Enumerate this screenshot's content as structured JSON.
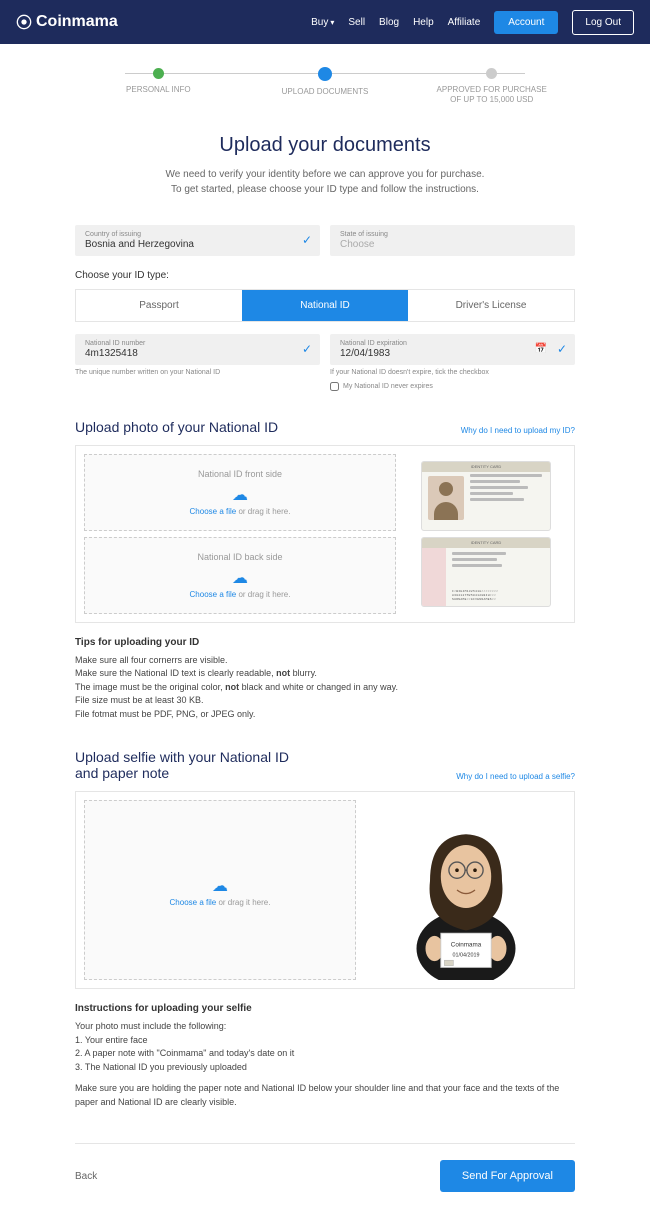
{
  "header": {
    "brand": "Coinmama",
    "nav": {
      "buy": "Buy",
      "sell": "Sell",
      "blog": "Blog",
      "help": "Help",
      "affiliate": "Affiliate"
    },
    "account": "Account",
    "logout": "Log Out"
  },
  "stepper": {
    "step1": "PERSONAL INFO",
    "step2": "UPLOAD DOCUMENTS",
    "step3": "APPROVED FOR PURCHASE\nOF UP TO 15,000 USD"
  },
  "title": "Upload your documents",
  "subtitle": "We need to verify your identity before we can approve you for purchase.\nTo get started, please choose your ID type and follow the instructions.",
  "country": {
    "label": "Country of issuing",
    "value": "Bosnia and Herzegovina"
  },
  "state": {
    "label": "State of issuing",
    "placeholder": "Choose"
  },
  "choose_label": "Choose your ID type:",
  "tabs": {
    "passport": "Passport",
    "national": "National ID",
    "license": "Driver's License"
  },
  "id_number": {
    "label": "National ID number",
    "value": "4m1325418",
    "hint": "The unique number written on your National ID"
  },
  "id_exp": {
    "label": "National ID expiration",
    "value": "12/04/1983",
    "hint": "If your National ID doesn't expire, tick the checkbox",
    "checkbox": "My National ID never expires"
  },
  "upload_id": {
    "title": "Upload photo of your National ID",
    "link": "Why do I need to upload my ID?",
    "front": "National ID front side",
    "back": "National ID back side",
    "choose": "Choose a file",
    "drag": " or drag it here."
  },
  "tips_id": {
    "title": "Tips for uploading your ID",
    "l1": "Make sure all four cornerrs are visible.",
    "l2a": "Make sure the National ID text is clearly readable, ",
    "l2b": "not",
    "l2c": " blurry.",
    "l3a": "The image must be the original color, ",
    "l3b": "not",
    "l3c": " black and white or changed in any way.",
    "l4": "File size must be at least 30 KB.",
    "l5": "File fotmat must be PDF, PNG, or JPEG only."
  },
  "upload_selfie": {
    "title": "Upload selfie with your National ID and paper note",
    "link": "Why do I need to upload a selfie?",
    "note_line1": "Coinmama",
    "note_line2": "01/04/2019"
  },
  "tips_selfie": {
    "title": "Instructions for uploading your selfie",
    "intro": "Your photo must include the following:",
    "l1": "1. Your entire face",
    "l2": "2. A paper note with \"Coinmama\" and today's date on it",
    "l3": "3. The National ID you previously uploaded",
    "outro": "Make sure you are holding the paper note and National ID below your shoulder line and that your face and the texts of the paper and National ID are clearly visible."
  },
  "footer": {
    "back": "Back",
    "submit": "Send For Approval"
  }
}
